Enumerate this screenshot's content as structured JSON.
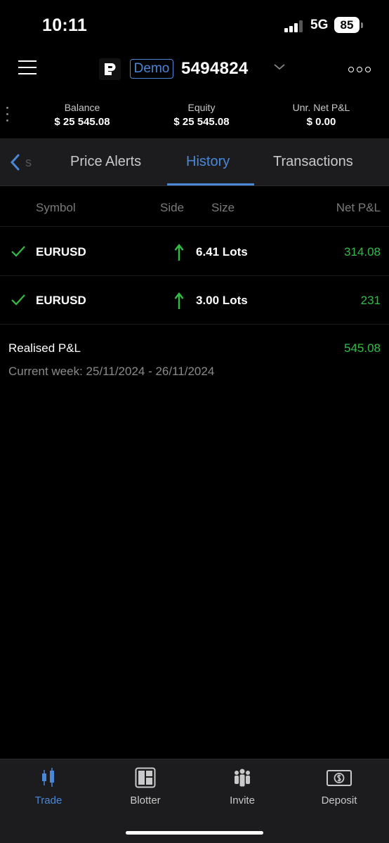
{
  "status": {
    "time": "10:11",
    "network": "5G",
    "battery": "85"
  },
  "header": {
    "demo_label": "Demo",
    "account_number": "5494824"
  },
  "summary": [
    {
      "label": "Balance",
      "value": "$ 25 545.08"
    },
    {
      "label": "Equity",
      "value": "$ 25 545.08"
    },
    {
      "label": "Unr. Net P&L",
      "value": "$ 0.00"
    }
  ],
  "tabs": {
    "partial_label": "s",
    "items": [
      {
        "label": "Price Alerts"
      },
      {
        "label": "History"
      },
      {
        "label": "Transactions"
      }
    ],
    "active": "History"
  },
  "table": {
    "headers": {
      "symbol": "Symbol",
      "side": "Side",
      "size": "Size",
      "pnl": "Net P&L"
    },
    "rows": [
      {
        "symbol": "EURUSD",
        "side": "buy",
        "size": "6.41 Lots",
        "pnl": "314.08"
      },
      {
        "symbol": "EURUSD",
        "side": "buy",
        "size": "3.00 Lots",
        "pnl": "231"
      }
    ]
  },
  "realised": {
    "label": "Realised P&L",
    "value": "545.08",
    "period": "Current week: 25/11/2024 - 26/11/2024"
  },
  "bottom_nav": [
    {
      "label": "Trade",
      "icon": "candlestick-icon"
    },
    {
      "label": "Blotter",
      "icon": "blotter-icon"
    },
    {
      "label": "Invite",
      "icon": "people-icon"
    },
    {
      "label": "Deposit",
      "icon": "dollar-bill-icon"
    }
  ],
  "colors": {
    "accent": "#4a87d6",
    "positive": "#2fbd46",
    "background": "#000000",
    "panel": "#1c1c1e"
  }
}
